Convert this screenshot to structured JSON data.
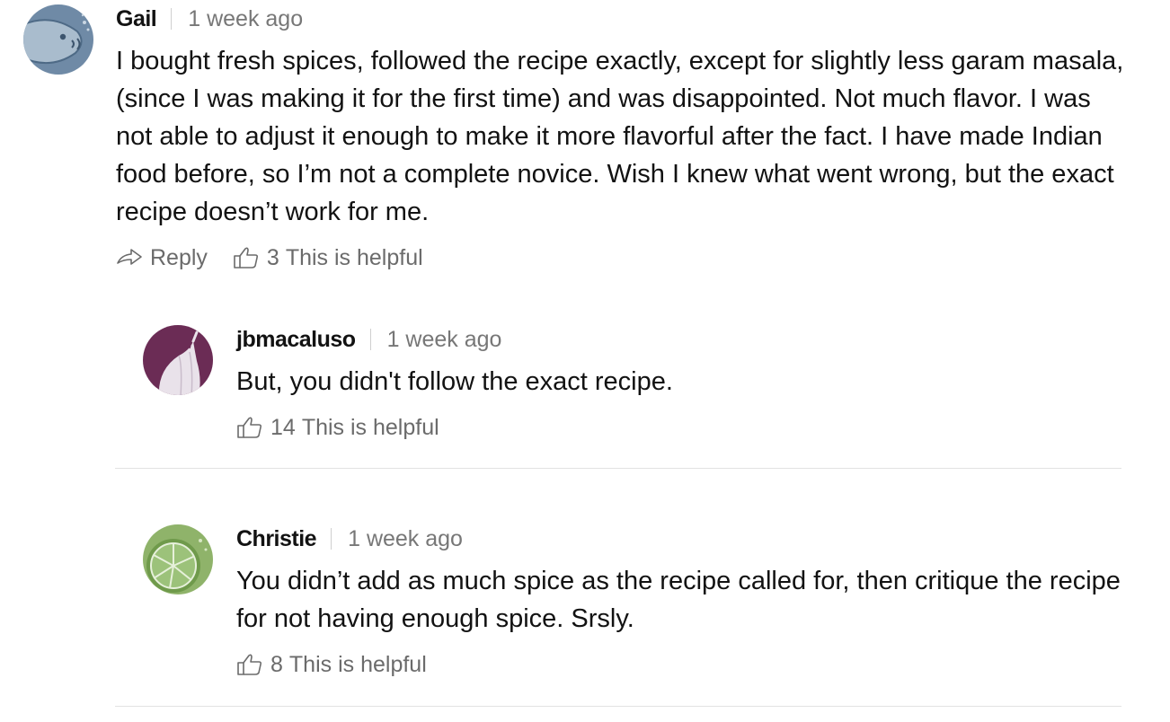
{
  "comments": [
    {
      "author": "Gail",
      "time": "1 week ago",
      "text": "I bought fresh spices, followed the recipe exactly, except for slightly less garam masala, (since I was making it for the first time) and was disappointed. Not much flavor. I was not able to adjust it enough to make it more flavorful after the fact. I have made Indian food before, so I’m not a complete novice. Wish I knew what went wrong, but the exact recipe doesn’t work for me.",
      "reply_label": "Reply",
      "helpful_count": "3",
      "helpful_label": "This is helpful",
      "avatar_icon": "fish-avatar",
      "avatar_color": "#6f8aa6"
    }
  ],
  "replies": [
    {
      "author": "jbmacaluso",
      "time": "1 week ago",
      "text": "But, you didn't follow the exact recipe.",
      "helpful_count": "14",
      "helpful_label": "This is helpful",
      "avatar_icon": "garlic-avatar",
      "avatar_color": "#6b2c55"
    },
    {
      "author": "Christie",
      "time": "1 week ago",
      "text": "You didn’t add as much spice as the recipe called for, then critique the recipe for not having enough spice. Srsly.",
      "helpful_count": "8",
      "helpful_label": "This is helpful",
      "avatar_icon": "lime-avatar",
      "avatar_color": "#8fb36a"
    }
  ],
  "colors": {
    "text": "#121212",
    "muted": "#6b6b6b",
    "divider": "#e2e2e2"
  }
}
